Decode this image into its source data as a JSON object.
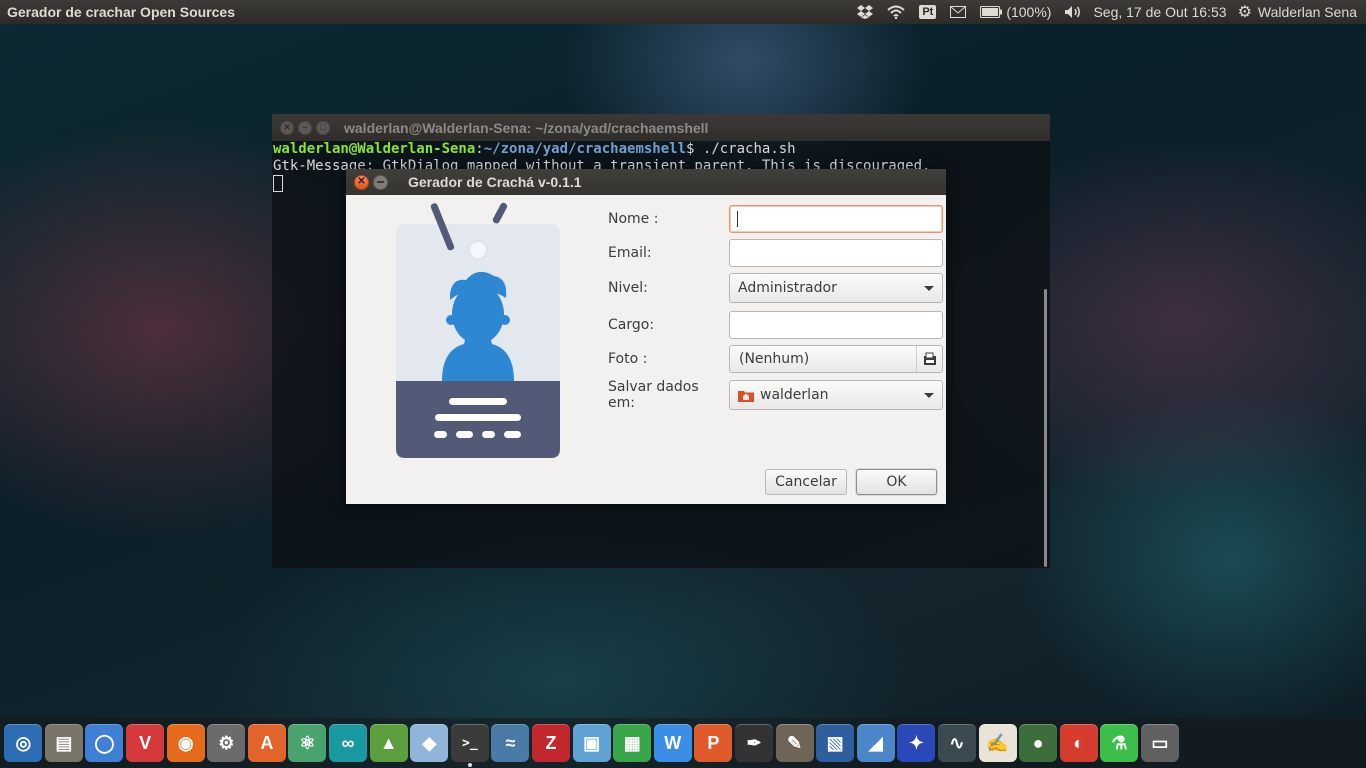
{
  "top_panel": {
    "app_title": "Gerador de crachar Open Sources",
    "battery_text": "(100%)",
    "language_label": "Pt",
    "datetime": "Seg, 17 de Out 16:53",
    "user_name": "Walderlan Sena"
  },
  "terminal": {
    "title": "walderlan@Walderlan-Sena: ~/zona/yad/crachaemshell",
    "prompt_user": "walderlan@Walderlan-Sena",
    "prompt_sep": ":",
    "prompt_path": "~/zona/yad/crachaemshell",
    "prompt_cmd": "$ ./cracha.sh",
    "output_line": "Gtk-Message: GtkDialog mapped without a transient parent. This is discouraged."
  },
  "dialog": {
    "title": "Gerador de Crachá v-0.1.1",
    "fields": {
      "nome_label": "Nome :",
      "nome_value": "",
      "email_label": "Email:",
      "email_value": "",
      "nivel_label": "Nivel:",
      "nivel_selected": "Administrador",
      "cargo_label": "Cargo:",
      "cargo_value": "",
      "foto_label": "Foto :",
      "foto_value": "(Nenhum)",
      "salvar_label": "Salvar dados em:",
      "salvar_selected": "walderlan"
    },
    "buttons": {
      "cancel": "Cancelar",
      "ok": "OK"
    }
  },
  "colors": {
    "badge_blue": "#2d87d3",
    "badge_card": "#e3e8ee",
    "badge_footer": "#525a78",
    "focus_border": "#e9916e"
  },
  "dock": {
    "items": [
      {
        "name": "ubuntu-dash-icon",
        "color": "#2c6db5",
        "glyph": "◎"
      },
      {
        "name": "files-icon",
        "color": "#7b7468",
        "glyph": "▤"
      },
      {
        "name": "chromium-icon",
        "color": "#3f7fd4",
        "glyph": "◯"
      },
      {
        "name": "vivaldi-icon",
        "color": "#d6393b",
        "glyph": "V"
      },
      {
        "name": "firefox-icon",
        "color": "#e56a1c",
        "glyph": "◉"
      },
      {
        "name": "system-settings-icon",
        "color": "#6b6b6b",
        "glyph": "⚙"
      },
      {
        "name": "software-center-icon",
        "color": "#e2642b",
        "glyph": "A"
      },
      {
        "name": "atom-icon",
        "color": "#4aa36e",
        "glyph": "⚛"
      },
      {
        "name": "arduino-icon",
        "color": "#1a9aa0",
        "glyph": "∞"
      },
      {
        "name": "android-studio-icon",
        "color": "#5d9e3f",
        "glyph": "▲"
      },
      {
        "name": "virtual-box-3d-icon",
        "color": "#8fb5d8",
        "glyph": "◆"
      },
      {
        "name": "terminal-icon",
        "color": "#3b3b3b",
        "glyph": ">_"
      },
      {
        "name": "mysql-workbench-icon",
        "color": "#4a7aa6",
        "glyph": "≈"
      },
      {
        "name": "filezilla-icon",
        "color": "#c1272d",
        "glyph": "Z"
      },
      {
        "name": "image-viewer-icon",
        "color": "#5fa3d4",
        "glyph": "▣"
      },
      {
        "name": "libreoffice-calc-icon",
        "color": "#3aa64a",
        "glyph": "▦"
      },
      {
        "name": "wps-writer-icon",
        "color": "#3a8ee6",
        "glyph": "W"
      },
      {
        "name": "wps-presentation-icon",
        "color": "#e05a2b",
        "glyph": "P"
      },
      {
        "name": "inkscape-icon",
        "color": "#333333",
        "glyph": "✒"
      },
      {
        "name": "gimp-icon",
        "color": "#6e6556",
        "glyph": "✎"
      },
      {
        "name": "virtualbox-icon",
        "color": "#2d5f9e",
        "glyph": "▧"
      },
      {
        "name": "wireshark-icon",
        "color": "#4a86c8",
        "glyph": "◢"
      },
      {
        "name": "weather-app-icon",
        "color": "#2b48b8",
        "glyph": "✦"
      },
      {
        "name": "system-monitor-icon",
        "color": "#3b4a50",
        "glyph": "∿"
      },
      {
        "name": "text-editor-icon",
        "color": "#e8e4d8",
        "glyph": "✍"
      },
      {
        "name": "globe-icon",
        "color": "#3c6e3c",
        "glyph": "●"
      },
      {
        "name": "colors-app-icon",
        "color": "#d63c2e",
        "glyph": "◐"
      },
      {
        "name": "app-beaker-icon",
        "color": "#3bbf4a",
        "glyph": "⚗"
      },
      {
        "name": "trash-icon",
        "color": "#606060",
        "glyph": "▭"
      }
    ]
  }
}
